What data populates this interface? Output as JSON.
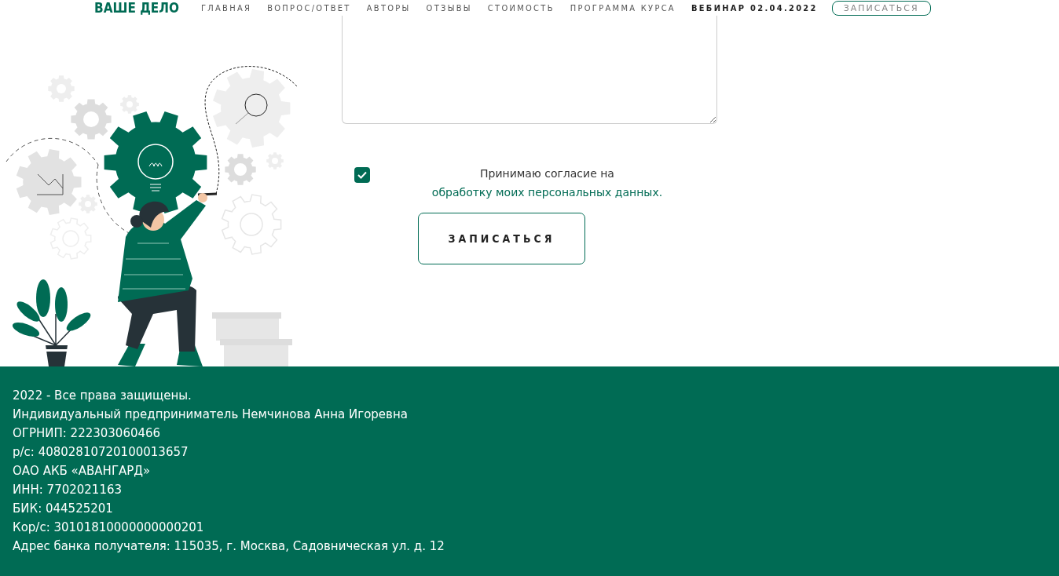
{
  "header": {
    "logo": "ВАШЕ ДЕЛО",
    "nav": [
      {
        "label": "ГЛАВНАЯ",
        "kind": "link"
      },
      {
        "label": "ВОПРОС/ОТВЕТ",
        "kind": "link"
      },
      {
        "label": "АВТОРЫ",
        "kind": "link"
      },
      {
        "label": "ОТЗЫВЫ",
        "kind": "link"
      },
      {
        "label": "СТОИМОСТЬ",
        "kind": "link"
      },
      {
        "label": "ПРОГРАММА КУРСА",
        "kind": "link"
      },
      {
        "label": "ВЕБИНАР 02.04.2022",
        "kind": "highlight"
      }
    ],
    "cta": "ЗАПИСАТЬСЯ"
  },
  "form": {
    "consent": {
      "checked": true,
      "text": "Принимаю согласие на",
      "link": "обработку моих персональных данных."
    },
    "submit": "ЗАПИСАТЬСЯ"
  },
  "footer": {
    "lines": [
      "2022 - Все права защищены.",
      "Индивидуальный предприниматель Немчинова Анна Игоревна",
      "ОГРНИП: 222303060466",
      "р/с: 40802810720100013657",
      "ОАО АКБ «АВАНГАРД»",
      "ИНН: 7702021163",
      "БИК: 044525201",
      "Кор/с: 30101810000000000201",
      "Адрес банка получателя: 115035, г. Москва, Садовническая ул. д. 12"
    ]
  }
}
